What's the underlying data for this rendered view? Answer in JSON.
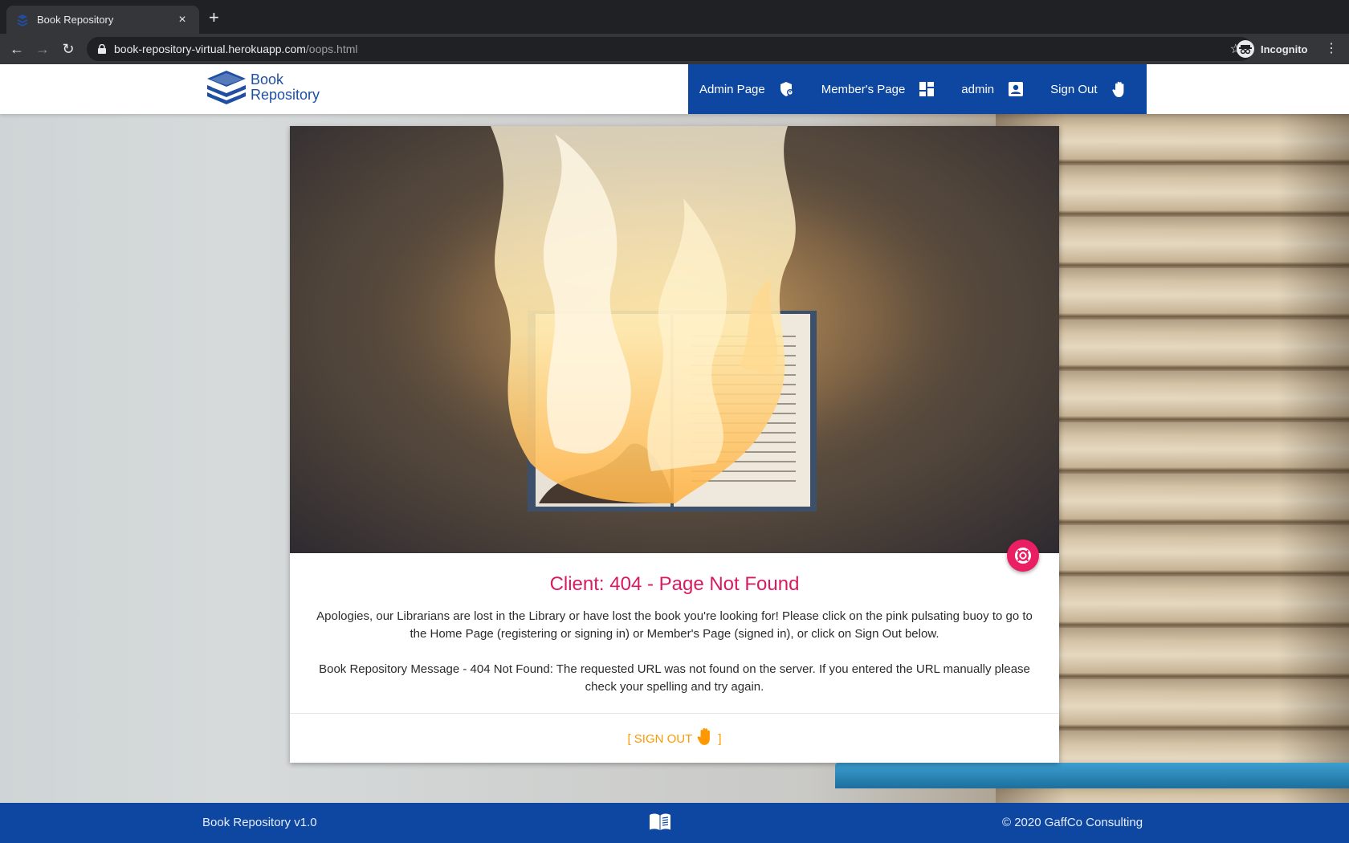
{
  "browser": {
    "tab_title": "Book Repository",
    "tab_close": "×",
    "new_tab": "+",
    "url_host": "book-repository-virtual.herokuapp.com",
    "url_path": "/oops.html",
    "profile_label": "Incognito",
    "nav_back": "←",
    "nav_forward": "→",
    "nav_reload": "↻",
    "star": "☆",
    "menu": "⋮"
  },
  "navbar": {
    "logo_line1": "Book",
    "logo_line2": "Repository",
    "items": [
      {
        "label": "Admin Page",
        "icon": "admin-shield-icon"
      },
      {
        "label": "Member's Page",
        "icon": "dashboard-icon"
      },
      {
        "label": "admin",
        "icon": "account-box-icon"
      },
      {
        "label": "Sign Out",
        "icon": "hand-icon"
      }
    ]
  },
  "card": {
    "title": "Client: 404 - Page Not Found",
    "paragraph1": "Apologies, our Librarians are lost in the Library or have lost the book you're looking for! Please click on the pink pulsating buoy to go to the Home Page (registering or signing in) or Member's Page (signed in), or click on Sign Out below.",
    "paragraph2": "Book Repository Message - 404 Not Found: The requested URL was not found on the server. If you entered the URL manually please check your spelling and try again.",
    "action_open": "[ SIGN OUT",
    "action_close": "]",
    "buoy_icon": "life-buoy-icon"
  },
  "footer": {
    "left": "Book Repository v1.0",
    "center_icon": "open-book-icon",
    "right": "© 2020 GaffCo Consulting"
  },
  "colors": {
    "primary": "#0d47a1",
    "accent_pink": "#e91e63",
    "title_pink": "#d81b60",
    "action_orange": "#ff9800"
  }
}
